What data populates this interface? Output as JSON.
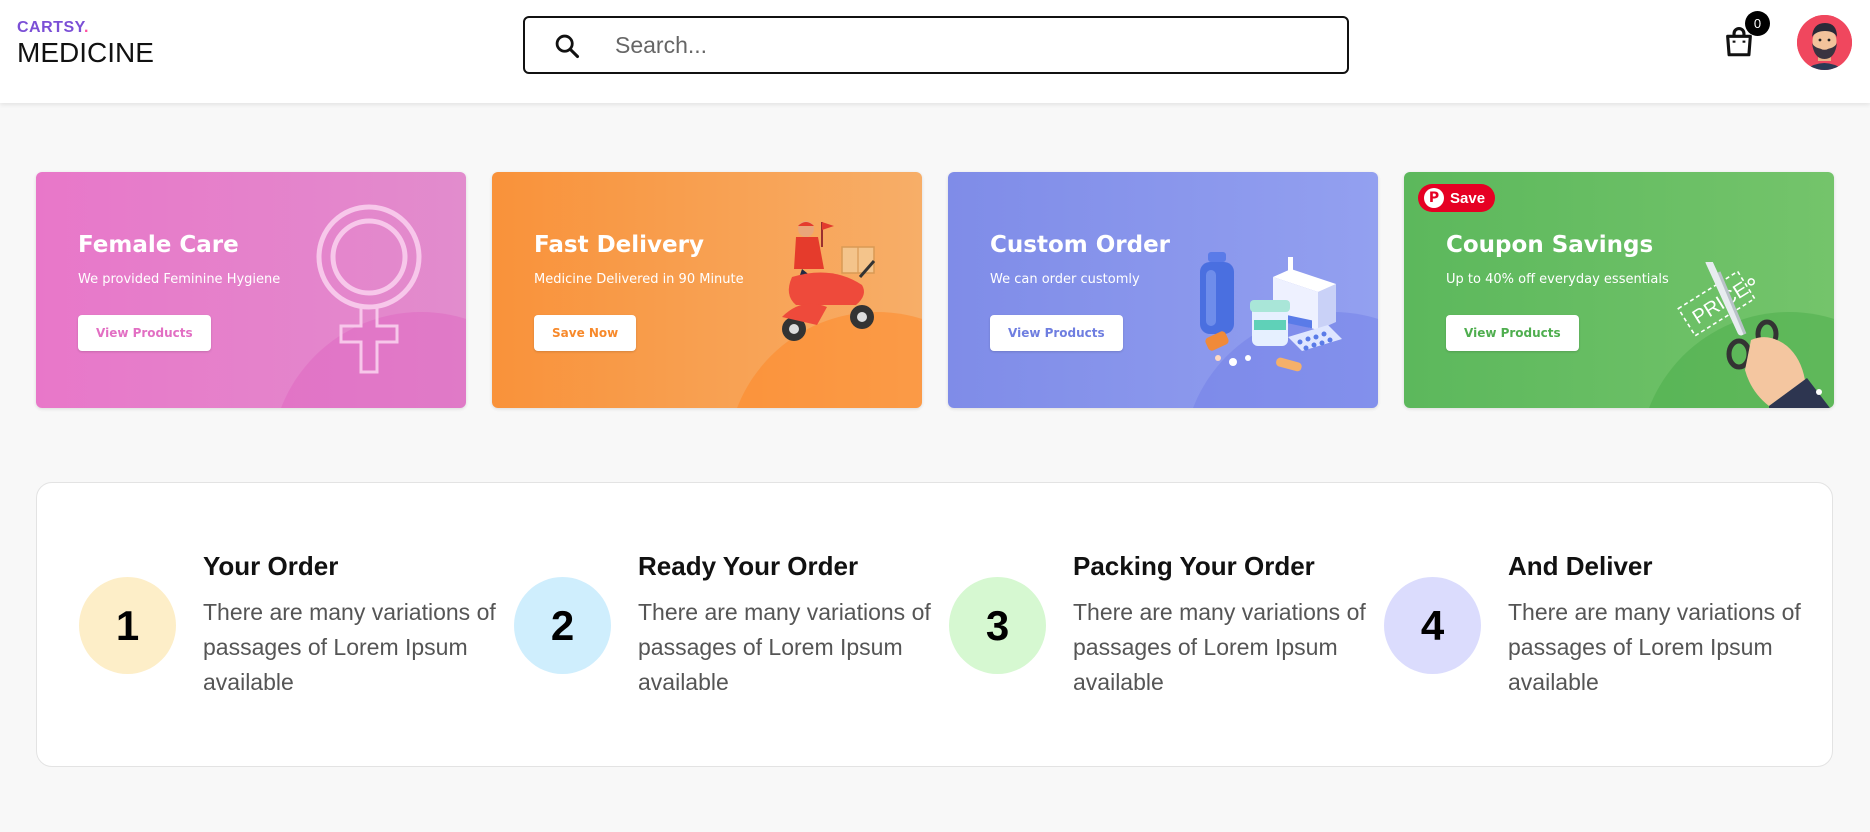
{
  "header": {
    "logo_top": "CARTSY",
    "logo_dot": ".",
    "logo_bottom": "MEDICINE",
    "search_placeholder": "Search...",
    "cart_count": "0"
  },
  "banners": [
    {
      "title": "Female Care",
      "subtitle": "We provided Feminine Hygiene",
      "button": "View Products",
      "color": "#e877c9",
      "button_color": "#e26fc3"
    },
    {
      "title": "Fast Delivery",
      "subtitle": "Medicine Delivered in 90 Minute",
      "button": "Save Now",
      "color": "#f9923a",
      "button_color": "#f7892b"
    },
    {
      "title": "Custom Order",
      "subtitle": "We can order customly",
      "button": "View Products",
      "color": "#7f8ce8",
      "button_color": "#6f7ee0"
    },
    {
      "title": "Coupon Savings",
      "subtitle": "Up to 40% off everyday essentials",
      "button": "View Products",
      "color": "#5cb85c",
      "button_color": "#4fae4f",
      "pin_label": "Save",
      "tag_text": "PRICE"
    }
  ],
  "steps": [
    {
      "number": "1",
      "title": "Your Order",
      "description": "There are many variations of passages of Lorem Ipsum available",
      "color": "#fdeec8"
    },
    {
      "number": "2",
      "title": "Ready Your Order",
      "description": "There are many variations of passages of Lorem Ipsum available",
      "color": "#cfeefd"
    },
    {
      "number": "3",
      "title": "Packing Your Order",
      "description": "There are many variations of passages of Lorem Ipsum available",
      "color": "#d6f8d1"
    },
    {
      "number": "4",
      "title": "And Deliver",
      "description": "There are many variations of passages of Lorem Ipsum available",
      "color": "#dbdcfd"
    }
  ]
}
